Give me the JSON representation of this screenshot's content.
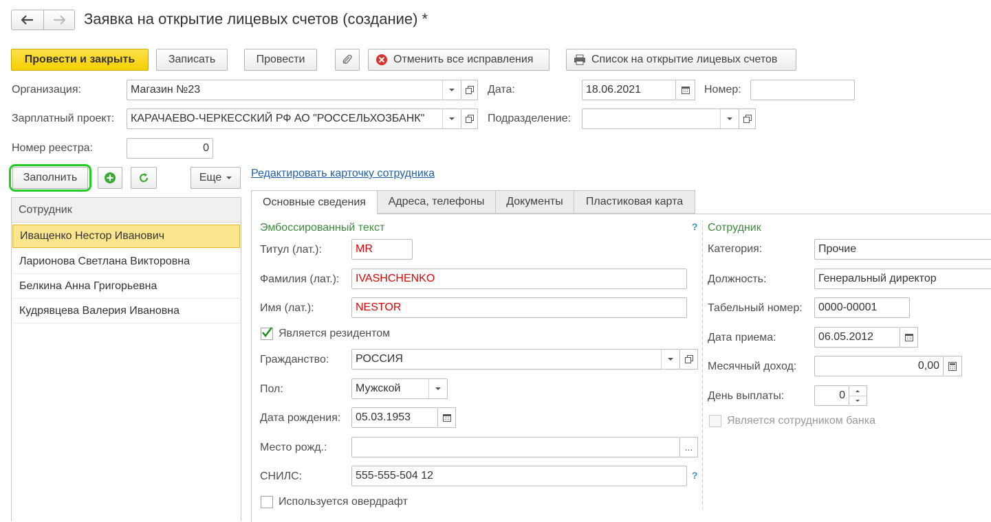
{
  "window": {
    "title": "Заявка на открытие лицевых счетов (создание) *"
  },
  "toolbar": {
    "post_close": "Провести и закрыть",
    "save": "Записать",
    "post": "Провести",
    "cancel_all": "Отменить все исправления",
    "print_list": "Список на открытие лицевых счетов"
  },
  "header": {
    "organization_label": "Организация:",
    "organization_value": "Магазин №23",
    "date_label": "Дата:",
    "date_value": "18.06.2021",
    "number_label": "Номер:",
    "number_value": "",
    "salary_project_label": "Зарплатный проект:",
    "salary_project_value": "КАРАЧАЕВО-ЧЕРКЕССКИЙ РФ АО \"РОССЕЛЬХОЗБАНК\"",
    "department_label": "Подразделение:",
    "department_value": "",
    "registry_number_label": "Номер реестра:",
    "registry_number_value": "0"
  },
  "employees_panel": {
    "fill_button": "Заполнить",
    "more_button": "Еще",
    "column_header": "Сотрудник",
    "rows": [
      "Иващенко Нестор Иванович",
      "Ларионова Светлана Викторовна",
      "Белкина Анна Григорьевна",
      "Кудрявцева Валерия Ивановна"
    ]
  },
  "edit_card_link": "Редактировать карточку сотрудника",
  "tabs": [
    "Основные сведения",
    "Адреса, телефоны",
    "Документы",
    "Пластиковая карта"
  ],
  "embossed": {
    "section_title": "Эмбоссированный текст",
    "help": "?",
    "title_label": "Титул (лат.):",
    "title_value": "MR",
    "surname_label": "Фамилия (лат.):",
    "surname_value": "IVASHCHENKO",
    "name_label": "Имя (лат.):",
    "name_value": "NESTOR",
    "resident_label": "Является резидентом",
    "citizenship_label": "Гражданство:",
    "citizenship_value": "РОССИЯ",
    "gender_label": "Пол:",
    "gender_value": "Мужской",
    "birth_date_label": "Дата рождения:",
    "birth_date_value": "05.03.1953",
    "birth_place_label": "Место рожд.:",
    "birth_place_value": "",
    "snils_label": "СНИЛС:",
    "snils_value": "555-555-504 12",
    "overdraft_label": "Используется овердрафт"
  },
  "employee": {
    "section_title": "Сотрудник",
    "category_label": "Категория:",
    "category_value": "Прочие",
    "position_label": "Должность:",
    "position_value": "Генеральный директор",
    "tab_number_label": "Табельный номер:",
    "tab_number_value": "0000-00001",
    "hire_date_label": "Дата приема:",
    "hire_date_value": "06.05.2012",
    "monthly_income_label": "Месячный доход:",
    "monthly_income_value": "0,00",
    "payday_label": "День выплаты:",
    "payday_value": "0",
    "bank_employee_label": "Является сотрудником банка"
  },
  "colors": {
    "primary_button": "#f5cf00",
    "section_title": "#3a8c3a",
    "link": "#1f5fa8",
    "latin_text": "#e00000",
    "highlight_ring": "#22cc22",
    "selected_row": "#fce68d"
  }
}
